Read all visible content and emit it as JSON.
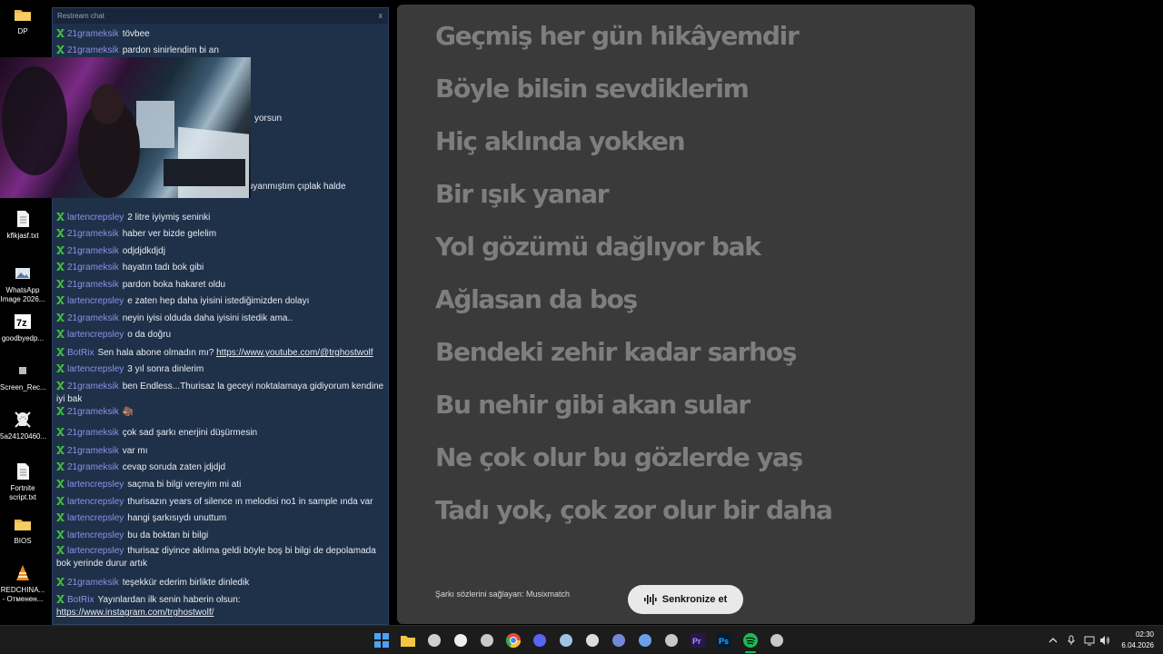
{
  "desktop_icons": [
    {
      "name": "folder-dp",
      "label": "DP",
      "icon": "folder-icon"
    },
    {
      "name": "kflkjasf",
      "label": "kflkjasf.txt",
      "icon": "text-file-icon"
    },
    {
      "name": "whatsapp-image",
      "label": "WhatsApp Image 2026...",
      "icon": "image-file-icon"
    },
    {
      "name": "goodbyedp",
      "label": "goodbyedp...",
      "icon": "7zip-icon"
    },
    {
      "name": "screen-rec",
      "label": "Screen_Rec...",
      "icon": "app-icon"
    },
    {
      "name": "5a24120460",
      "label": "5a24120460...",
      "icon": "skull-icon"
    },
    {
      "name": "fortnite-script",
      "label": "Fortnite script.txt",
      "icon": "text-file-icon"
    },
    {
      "name": "bios",
      "label": "BIOS",
      "icon": "folder-icon"
    },
    {
      "name": "redchina",
      "label": "REDCHINA... - Отменен...",
      "icon": "vlc-icon"
    }
  ],
  "chat": {
    "title": "Restream chat",
    "close": "x",
    "messages": [
      {
        "user": "21grameksik",
        "text": "tövbee"
      },
      {
        "user": "21grameksik",
        "text": "pardon sinirlendim bi an"
      },
      {
        "user": "",
        "text": "yorsun"
      },
      {
        "user": "",
        "text": "ek başıma sabah uyandığımda balkonda yerde uyanmıştım çıplak halde"
      },
      {
        "user": "lartencrepsley",
        "text": "2 litre iyiymiş seninki"
      },
      {
        "user": "21grameksik",
        "text": "haber ver bizde gelelim"
      },
      {
        "user": "21grameksik",
        "text": "odjdjdkdjdj"
      },
      {
        "user": "21grameksik",
        "text": "hayatın tadı bok gibi"
      },
      {
        "user": "21grameksik",
        "text": "pardon boka hakaret oldu"
      },
      {
        "user": "lartencrepsley",
        "text": "e zaten hep daha iyisini istediğimizden dolayı"
      },
      {
        "user": "21grameksik",
        "text": "neyin iyisi olduda daha iyisini istedik ama.."
      },
      {
        "user": "lartencrepsley",
        "text": "o da doğru"
      },
      {
        "user": "BotRix",
        "text": "Sen hala abone olmadın mı? ",
        "link": "https://www.youtube.com/@trghostwolf"
      },
      {
        "user": "lartencrepsley",
        "text": "3 yıl sonra dinlerim"
      },
      {
        "user": "21grameksik",
        "text": "ben Endless...Thurisaz la geceyi noktalamaya gidiyorum kendine iyi bak"
      },
      {
        "user": "21grameksik",
        "text": "🦣"
      },
      {
        "user": "21grameksik",
        "text": "çok sad şarkı enerjini düşürmesin"
      },
      {
        "user": "21grameksik",
        "text": "var mı"
      },
      {
        "user": "21grameksik",
        "text": "cevap soruda zaten jdjdjd"
      },
      {
        "user": "lartencrepsley",
        "text": "saçma bi bilgi vereyim mi ati"
      },
      {
        "user": "lartencrepsley",
        "text": "thurisazın years of silence ın melodisi no1 in sample ında var"
      },
      {
        "user": "lartencrepsley",
        "text": "hangi şarkısıydı unuttum"
      },
      {
        "user": "lartencrepsley",
        "text": "bu da boktan bi bilgi"
      },
      {
        "user": "lartencrepsley",
        "text": "thurisaz diyince aklıma geldi böyle boş bi bilgi de depolamada bok yerinde durur artık"
      },
      {
        "user": "21grameksik",
        "text": "teşekkür ederim birlikte dinledik"
      },
      {
        "user": "BotRix",
        "text": "Yayınlardan ilk senin haberin olsun: ",
        "link": "https://www.instagram.com/trghostwolf/"
      }
    ]
  },
  "lyrics": {
    "lines": [
      "Geçmiş her gün hikâyemdir",
      "Böyle bilsin sevdiklerim",
      "Hiç aklında yokken",
      "Bir ışık yanar",
      "Yol gözümü dağlıyor bak",
      "Ağlasan da boş",
      "Bendeki zehir kadar sarhoş",
      "Bu nehir gibi akan sular",
      "Ne çok olur bu gözlerde yaş",
      "Tadı yok, çok zor olur bir daha"
    ],
    "provider": "Şarkı sözlerini sağlayan: Musixmatch",
    "sync_label": "Senkronize et"
  },
  "taskbar": {
    "apps": [
      "windows-start-icon",
      "file-explorer-icon",
      "store-icon",
      "chatgpt-icon",
      "app-icon",
      "chrome-icon",
      "discord-alt-icon",
      "steam-icon",
      "epic-games-icon",
      "discord-icon",
      "browser-icon",
      "app-icon",
      "premiere-icon",
      "photoshop-icon",
      "spotify-icon",
      "app-icon"
    ],
    "time": "02:30",
    "date": "6.04.2026"
  },
  "colors": {
    "chat_bg": "#1f3149",
    "lyrics_bg": "#3a3a3a",
    "lyric_text": "#7e7e7e",
    "username": "#8f8fe8"
  }
}
